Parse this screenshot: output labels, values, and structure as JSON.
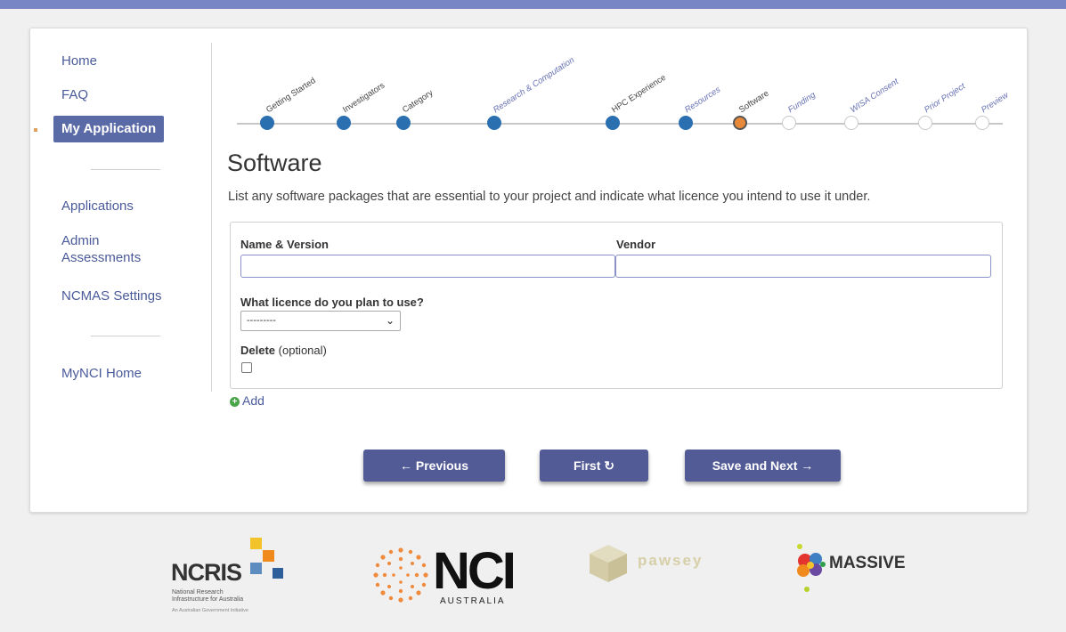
{
  "nav": {
    "home": "Home",
    "faq": "FAQ",
    "my_application": "My Application",
    "applications": "Applications",
    "admin_assessments": "Admin Assessments",
    "ncmas_settings": "NCMAS Settings",
    "mynci_home": "MyNCI Home"
  },
  "stepper": {
    "steps": [
      {
        "label": "Getting Started",
        "state": "done"
      },
      {
        "label": "Investigators",
        "state": "done"
      },
      {
        "label": "Category",
        "state": "done"
      },
      {
        "label": "Research & Computation",
        "state": "done"
      },
      {
        "label": "HPC Experience",
        "state": "done"
      },
      {
        "label": "Resources",
        "state": "done"
      },
      {
        "label": "Software",
        "state": "current"
      },
      {
        "label": "Funding",
        "state": "todo"
      },
      {
        "label": "WISA Consent",
        "state": "todo"
      },
      {
        "label": "Prior Project",
        "state": "todo"
      },
      {
        "label": "Preview",
        "state": "todo"
      }
    ]
  },
  "page": {
    "title": "Software",
    "intro": "List any software packages that are essential to your project and indicate what licence you intend to use it under."
  },
  "form": {
    "name_version_label": "Name & Version",
    "name_version_value": "",
    "vendor_label": "Vendor",
    "vendor_value": "",
    "licence_label": "What licence do you plan to use?",
    "licence_selected": "---------",
    "delete_label": "Delete",
    "delete_optional": "(optional)",
    "delete_checked": false,
    "add_label": "Add"
  },
  "buttons": {
    "previous": "← Previous",
    "first": "First ↻",
    "save_next": "Save and Next →"
  },
  "footer": {
    "ncris_word": "NCRIS",
    "ncris_sub_1": "National Research",
    "ncris_sub_2": "Infrastructure for Australia",
    "ncris_sub_3": "An Australian Government Initiative",
    "nci_word": "NCI",
    "nci_sub": "AUSTRALIA",
    "pawsey_word": "pawsey",
    "massive_word": "MASSIVE"
  },
  "colors": {
    "accent": "#535b97",
    "step_done": "#2a6fb0",
    "step_current": "#e8893a",
    "top_bar": "#7986c6"
  }
}
